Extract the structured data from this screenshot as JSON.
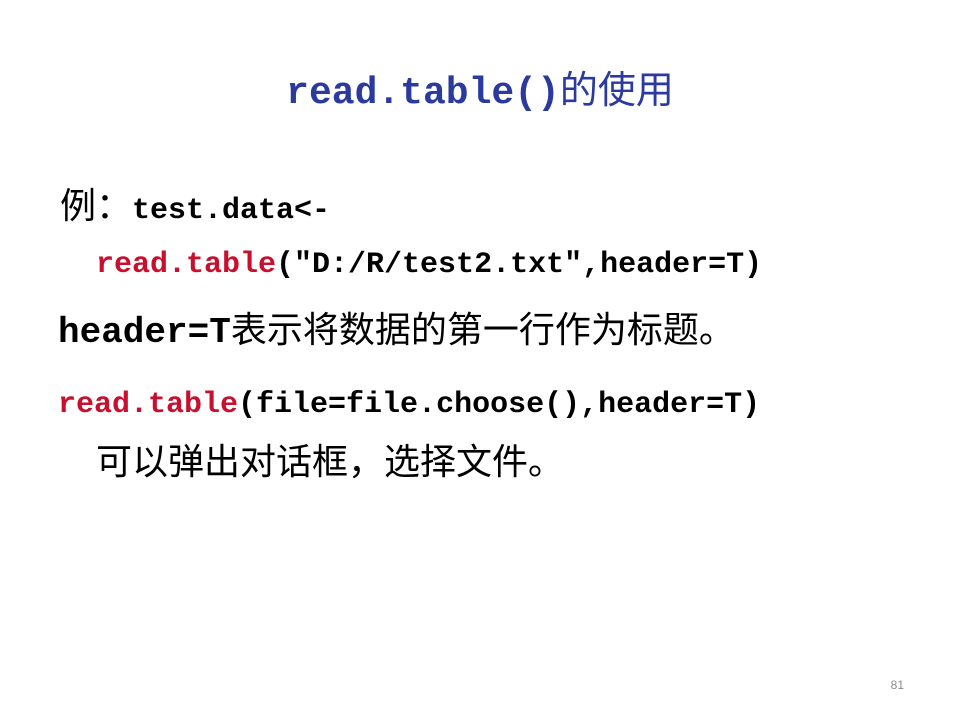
{
  "title": {
    "code": "read.table()",
    "text": "的使用"
  },
  "lines": [
    {
      "prefix": "例：",
      "code": "test.data<-"
    },
    {
      "func": "read.table",
      "args": "(\"D:/R/test2.txt\",header=T)"
    },
    {
      "code": "header=T",
      "text": "表示将数据的第一行作为标题。"
    },
    {
      "func": "read.table",
      "args": "(file=file.choose(),header=T)"
    },
    {
      "text": "可以弹出对话框，选择文件。"
    }
  ],
  "page_number": "81",
  "colors": {
    "title": "#2b3a9e",
    "function": "#c8102e",
    "text": "#000000",
    "page_number": "#8c8c8c"
  }
}
